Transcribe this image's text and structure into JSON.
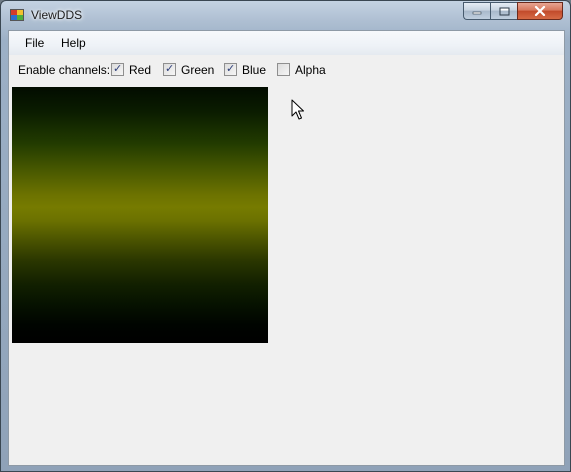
{
  "window": {
    "title": "ViewDDS",
    "icon": "app-icon"
  },
  "caption_buttons": {
    "minimize_icon": "minimize-icon",
    "maximize_icon": "maximize-icon",
    "close_icon": "close-icon"
  },
  "menu": {
    "items": [
      {
        "label": "File"
      },
      {
        "label": "Help"
      }
    ]
  },
  "channels": {
    "label": "Enable channels:",
    "options": [
      {
        "label": "Red",
        "checked": true
      },
      {
        "label": "Green",
        "checked": true
      },
      {
        "label": "Blue",
        "checked": true
      },
      {
        "label": "Alpha",
        "checked": false
      }
    ]
  },
  "image": {
    "description_colors": [
      "#020c00",
      "#767b00",
      "#000000"
    ]
  },
  "pointer": "cursor-arrow-icon"
}
